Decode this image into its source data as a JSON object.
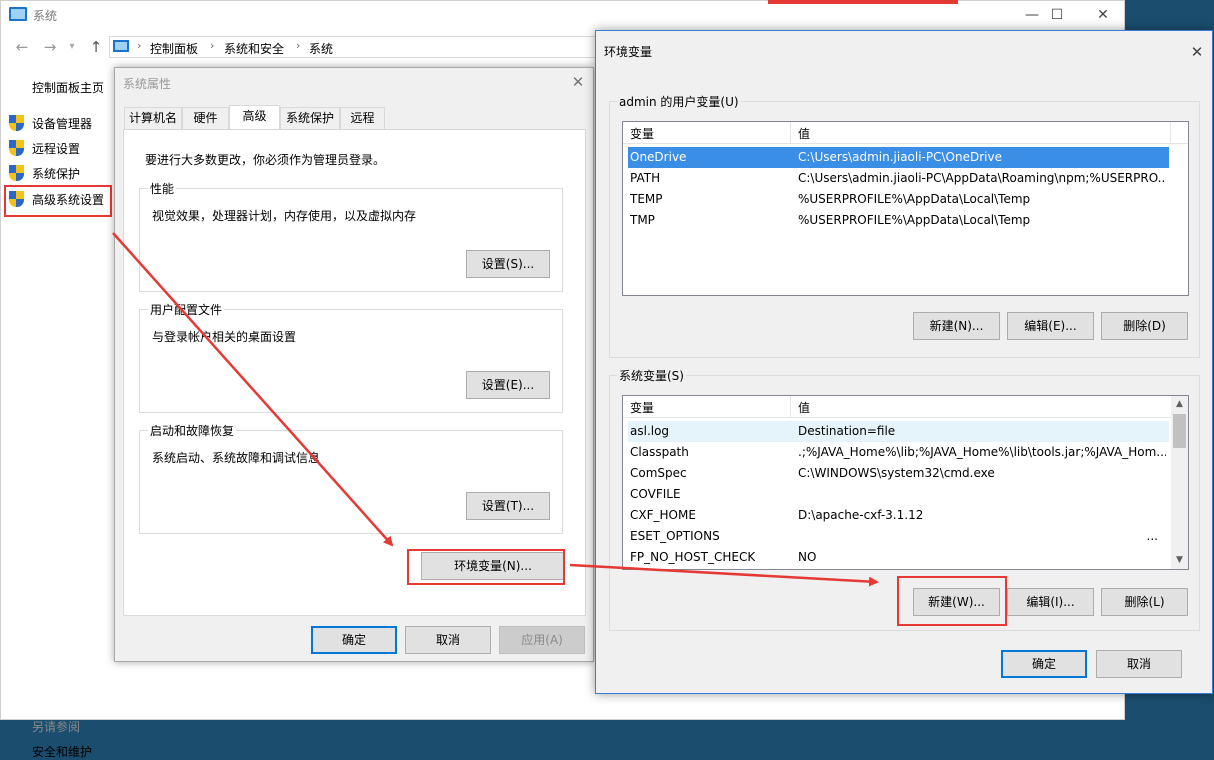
{
  "system_window": {
    "title": "系统",
    "controls": {
      "minimize": "—",
      "maximize": "☐",
      "close": "✕"
    },
    "nav": {
      "back": "←",
      "forward": "→",
      "up": "↑"
    },
    "breadcrumb": [
      "控制面板",
      "系统和安全",
      "系统"
    ],
    "breadcrumb_sep": "›",
    "left_nav": {
      "home": "控制面板主页",
      "items": [
        "设备管理器",
        "远程设置",
        "系统保护",
        "高级系统设置"
      ],
      "see_also": "另请参阅",
      "security": "安全和维护"
    }
  },
  "system_properties": {
    "title": "系统属性",
    "close": "✕",
    "tabs": [
      "计算机名",
      "硬件",
      "高级",
      "系统保护",
      "远程"
    ],
    "admin_note": "要进行大多数更改，你必须作为管理员登录。",
    "performance": {
      "title": "性能",
      "desc": "视觉效果，处理器计划，内存使用，以及虚拟内存",
      "button": "设置(S)..."
    },
    "user_profiles": {
      "title": "用户配置文件",
      "desc": "与登录帐户相关的桌面设置",
      "button": "设置(E)..."
    },
    "startup_recovery": {
      "title": "启动和故障恢复",
      "desc": "系统启动、系统故障和调试信息",
      "button": "设置(T)..."
    },
    "env_button": "环境变量(N)...",
    "ok": "确定",
    "cancel": "取消",
    "apply": "应用(A)"
  },
  "env_vars": {
    "title": "环境变量",
    "close": "✕",
    "user_group_title": "admin 的用户变量(U)",
    "col_var": "变量",
    "col_value": "值",
    "user_vars": [
      {
        "name": "OneDrive",
        "value": "C:\\Users\\admin.jiaoli-PC\\OneDrive"
      },
      {
        "name": "PATH",
        "value": "C:\\Users\\admin.jiaoli-PC\\AppData\\Roaming\\npm;%USERPRO..."
      },
      {
        "name": "TEMP",
        "value": "%USERPROFILE%\\AppData\\Local\\Temp"
      },
      {
        "name": "TMP",
        "value": "%USERPROFILE%\\AppData\\Local\\Temp"
      }
    ],
    "user_buttons": {
      "new": "新建(N)...",
      "edit": "编辑(E)...",
      "delete": "删除(D)"
    },
    "system_group_title": "系统变量(S)",
    "system_vars": [
      {
        "name": "asl.log",
        "value": "Destination=file"
      },
      {
        "name": "Classpath",
        "value": ".;%JAVA_Home%\\lib;%JAVA_Home%\\lib\\tools.jar;%JAVA_Hom..."
      },
      {
        "name": "ComSpec",
        "value": "C:\\WINDOWS\\system32\\cmd.exe"
      },
      {
        "name": "COVFILE",
        "value": ""
      },
      {
        "name": "CXF_HOME",
        "value": "D:\\apache-cxf-3.1.12"
      },
      {
        "name": "ESET_OPTIONS",
        "value": "..."
      },
      {
        "name": "FP_NO_HOST_CHECK",
        "value": "NO"
      }
    ],
    "system_buttons": {
      "new": "新建(W)...",
      "edit": "编辑(I)...",
      "delete": "删除(L)"
    },
    "ok": "确定",
    "cancel": "取消",
    "scroll_up": "▲",
    "scroll_down": "▼"
  },
  "colors": {
    "highlight_red": "#e53935",
    "selection_blue": "#3a8ee6",
    "dialog_bg": "#f0f0f0",
    "desktop_blue": "#1a4d6e"
  }
}
